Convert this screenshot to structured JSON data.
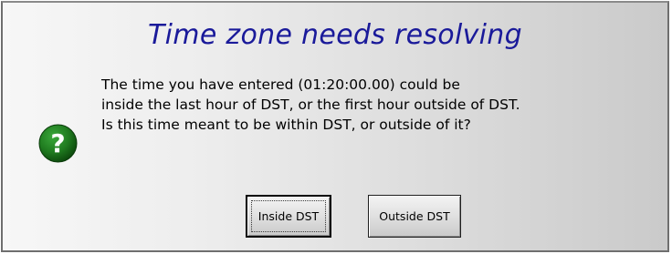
{
  "dialog": {
    "title": "Time zone needs resolving",
    "icon": "question-icon",
    "message_lines": [
      "The time you have entered (01:20:00.00) could be",
      "inside the last hour of DST, or the first hour outside of DST.",
      "Is this time meant to be within DST, or outside of it?"
    ],
    "buttons": {
      "inside_label": "Inside DST",
      "outside_label": "Outside DST"
    }
  },
  "colors": {
    "title_text": "#1a1a9a",
    "icon_green": "#1f7a1f"
  }
}
